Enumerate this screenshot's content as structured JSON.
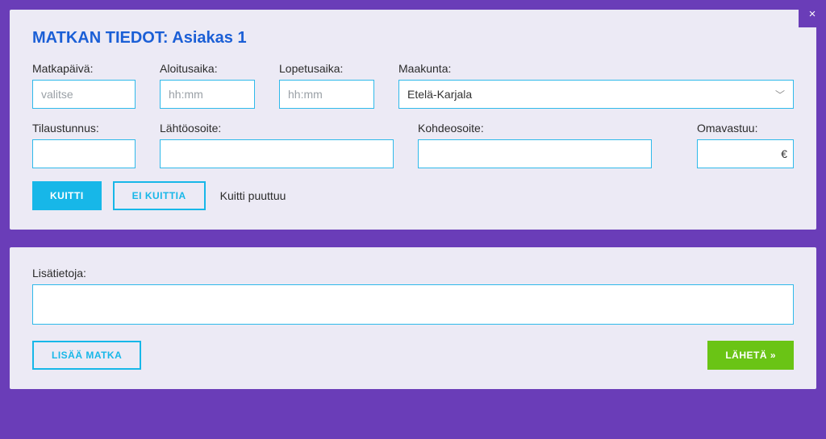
{
  "header": {
    "title": "MATKAN TIEDOT: Asiakas 1",
    "close_icon": "×"
  },
  "fields": {
    "matkapaiva": {
      "label": "Matkapäivä:",
      "placeholder": "valitse",
      "value": ""
    },
    "aloitusaika": {
      "label": "Aloitusaika:",
      "placeholder": "hh:mm",
      "value": ""
    },
    "lopetusaika": {
      "label": "Lopetusaika:",
      "placeholder": "hh:mm",
      "value": ""
    },
    "maakunta": {
      "label": "Maakunta:",
      "selected": "Etelä-Karjala"
    },
    "tilaustunnus": {
      "label": "Tilaustunnus:",
      "value": ""
    },
    "lahtoosoite": {
      "label": "Lähtöosoite:",
      "value": ""
    },
    "kohdeosoite": {
      "label": "Kohdeosoite:",
      "value": ""
    },
    "omavastuu": {
      "label": "Omavastuu:",
      "value": "",
      "currency": "€"
    },
    "lisatietoja": {
      "label": "Lisätietoja:",
      "value": ""
    }
  },
  "buttons": {
    "kuitti": "KUITTI",
    "ei_kuittia": "EI KUITTIA",
    "lisaa_matka": "LISÄÄ MATKA",
    "laheta": "LÄHETÄ »"
  },
  "status": {
    "kuitti_status": "Kuitti puuttuu"
  }
}
